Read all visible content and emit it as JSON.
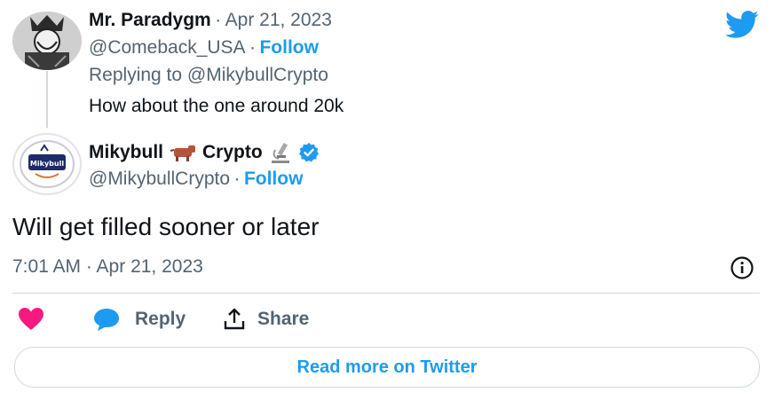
{
  "colors": {
    "accent": "#1d9bf0",
    "muted": "#536471",
    "text": "#0f1419",
    "like": "#f91880",
    "border": "#cfd9de"
  },
  "parent_tweet": {
    "author_name": "Mr. Paradygm",
    "separator": "·",
    "date": "Apr 21, 2023",
    "handle": "@Comeback_USA",
    "follow_sep": "·",
    "follow_label": "Follow",
    "replying_to": "Replying to @MikybullCrypto",
    "text": "How about the one around 20k",
    "avatar_icon": "playing-card-king-avatar"
  },
  "main_tweet": {
    "author_name_part1": "Mikybull",
    "author_name_part2": "Crypto",
    "emoji_icons": [
      "bull-emoji-icon",
      "microscope-emoji-icon"
    ],
    "verified_icon": "verified-badge-icon",
    "handle": "@MikybullCrypto",
    "follow_sep": "·",
    "follow_label": "Follow",
    "avatar_text": "Mikybull",
    "text": "Will get filled sooner or later",
    "timestamp": "7:01 AM · Apr 21, 2023"
  },
  "actions": {
    "like_icon": "heart-icon",
    "reply_icon": "speech-bubble-icon",
    "reply_label": "Reply",
    "share_icon": "share-upload-icon",
    "share_label": "Share",
    "info_icon": "info-icon"
  },
  "footer": {
    "read_more_label": "Read more on Twitter"
  },
  "brand_icon": "twitter-bird-icon"
}
